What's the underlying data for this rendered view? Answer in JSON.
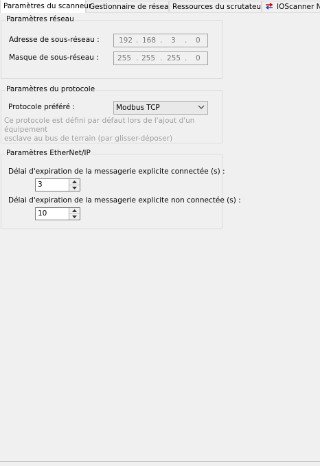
{
  "tabs": [
    {
      "label": "Paramètres du scanneur",
      "active": true
    },
    {
      "label": "Gestionnaire de réseau",
      "active": false
    },
    {
      "label": "Ressources du scrutateur",
      "active": false
    },
    {
      "label": "IOScanner N",
      "active": false,
      "icon": "arrows-exchange-icon"
    }
  ],
  "network": {
    "title": "Paramètres réseau",
    "subnet_address_label": "Adresse de sous-réseau :",
    "subnet_address": [
      "192",
      "168",
      "3",
      "0"
    ],
    "subnet_mask_label": "Masque de sous-réseau :",
    "subnet_mask": [
      "255",
      "255",
      "255",
      "0"
    ],
    "dot": "."
  },
  "protocol": {
    "title": "Paramètres du protocole",
    "preferred_label": "Protocole préféré :",
    "preferred_value": "Modbus TCP",
    "hint_line1": "Ce protocole est défini par défaut lors de l'ajout d'un équipement",
    "hint_line2": "esclave au bus de terrain (par glisser-déposer)"
  },
  "ethernetip": {
    "title": "Paramètres EtherNet/IP",
    "connected_label": "Délai d'expiration de la messagerie explicite connectée (s) :",
    "connected_value": "3",
    "unconnected_label": "Délai d'expiration de la messagerie explicite non connectée (s) :",
    "unconnected_value": "10"
  },
  "colors": {
    "background": "#f0f0f0",
    "disabled_text": "#a0a0a0",
    "tab_icon_red": "#d40000",
    "tab_icon_blue": "#1f4fc9"
  }
}
